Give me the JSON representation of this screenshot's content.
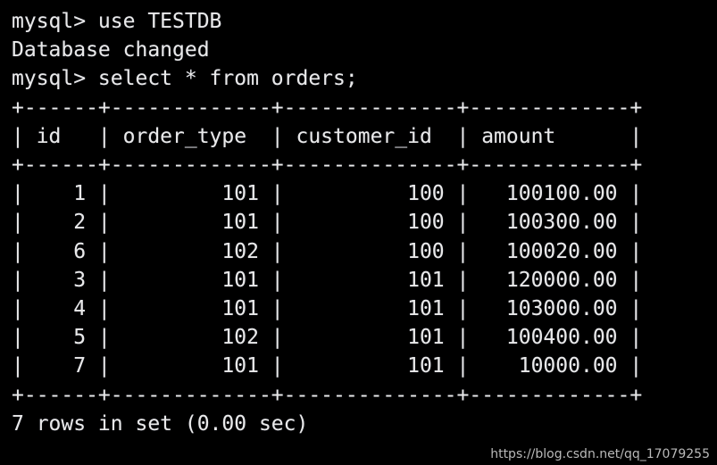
{
  "terminal": {
    "background_color": "#000000",
    "text_color": "#e9e9e9",
    "prompt": "mysql>",
    "commands": [
      "mysql> use TESTDB",
      "Database changed",
      "mysql> select * from orders;"
    ],
    "status_line": "7 rows in set (0.00 sec)"
  },
  "watermark": {
    "text": "https://blog.csdn.net/qq_17079255",
    "color": "#b9b9b9"
  },
  "result_table": {
    "type": "table",
    "columns": [
      {
        "name": "id",
        "width": 4,
        "align": "right"
      },
      {
        "name": "order_type",
        "width": 11,
        "align": "right"
      },
      {
        "name": "customer_id",
        "width": 12,
        "align": "right"
      },
      {
        "name": "amount",
        "width": 11,
        "align": "right"
      }
    ],
    "rows": [
      {
        "id": "1",
        "order_type": "101",
        "customer_id": "100",
        "amount": "100100.00"
      },
      {
        "id": "2",
        "order_type": "101",
        "customer_id": "100",
        "amount": "100300.00"
      },
      {
        "id": "6",
        "order_type": "102",
        "customer_id": "100",
        "amount": "100020.00"
      },
      {
        "id": "3",
        "order_type": "101",
        "customer_id": "101",
        "amount": "120000.00"
      },
      {
        "id": "4",
        "order_type": "101",
        "customer_id": "101",
        "amount": "103000.00"
      },
      {
        "id": "5",
        "order_type": "102",
        "customer_id": "101",
        "amount": "100400.00"
      },
      {
        "id": "7",
        "order_type": "101",
        "customer_id": "101",
        "amount": "10000.00"
      }
    ],
    "row_count": 7,
    "elapsed_seconds": "0.00"
  }
}
